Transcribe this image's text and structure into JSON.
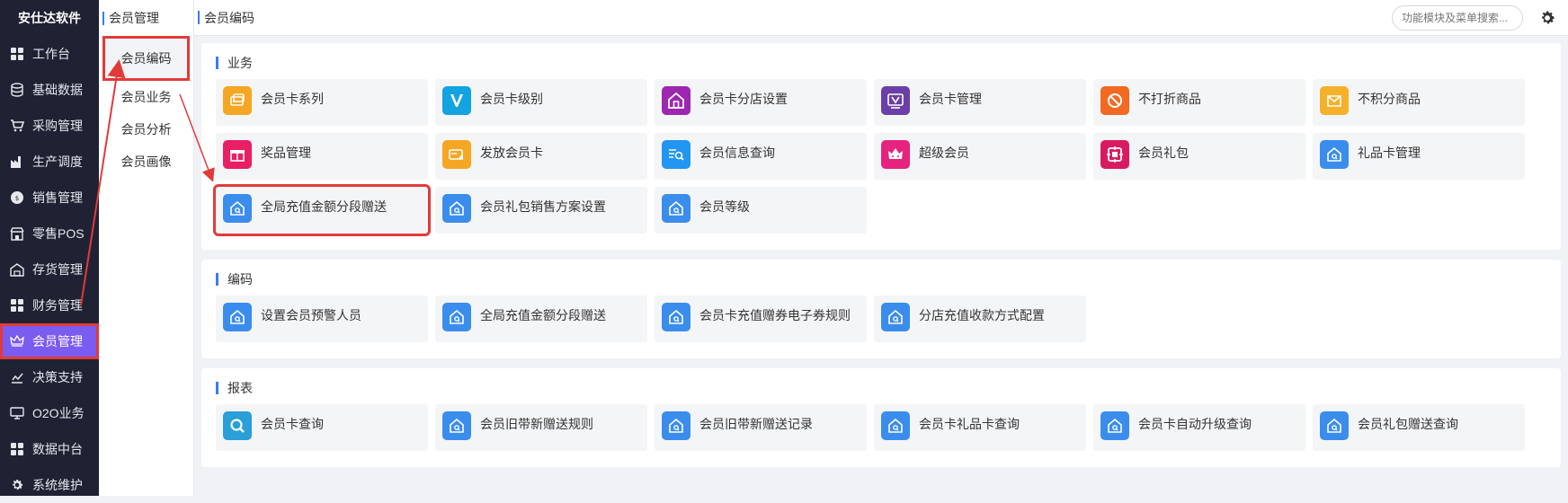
{
  "brand": "安仕达软件",
  "sidebar": {
    "items": [
      {
        "label": "工作台",
        "icon": "grid-icon",
        "active": false
      },
      {
        "label": "基础数据",
        "icon": "database-icon",
        "active": false
      },
      {
        "label": "采购管理",
        "icon": "cart-icon",
        "active": false
      },
      {
        "label": "生产调度",
        "icon": "factory-icon",
        "active": false
      },
      {
        "label": "销售管理",
        "icon": "sales-icon",
        "active": false
      },
      {
        "label": "零售POS",
        "icon": "store-icon",
        "active": false
      },
      {
        "label": "存货管理",
        "icon": "warehouse-icon",
        "active": false
      },
      {
        "label": "财务管理",
        "icon": "grid-icon",
        "active": false
      },
      {
        "label": "会员管理",
        "icon": "crown-icon",
        "active": true
      },
      {
        "label": "决策支持",
        "icon": "chart-icon",
        "active": false
      },
      {
        "label": "O2O业务",
        "icon": "monitor-icon",
        "active": false
      },
      {
        "label": "数据中台",
        "icon": "grid-icon",
        "active": false
      },
      {
        "label": "系统维护",
        "icon": "gear-icon",
        "active": false
      }
    ]
  },
  "submenu": {
    "title": "会员管理",
    "items": [
      {
        "label": "会员编码",
        "active": true
      },
      {
        "label": "会员业务",
        "active": false
      },
      {
        "label": "会员分析",
        "active": false
      },
      {
        "label": "会员画像",
        "active": false
      }
    ]
  },
  "topbar": {
    "breadcrumb": "会员编码",
    "search_placeholder": "功能模块及菜单搜索..."
  },
  "sections": [
    {
      "title": "业务",
      "cards": [
        {
          "label": "会员卡系列",
          "color": "#f5a623",
          "icon": "card-series-icon"
        },
        {
          "label": "会员卡级别",
          "color": "#13a3e0",
          "icon": "v-level-icon"
        },
        {
          "label": "会员卡分店设置",
          "color": "#9c27b0",
          "icon": "home-store-icon"
        },
        {
          "label": "会员卡管理",
          "color": "#6a3fa8",
          "icon": "card-manage-icon"
        },
        {
          "label": "不打折商品",
          "color": "#f26a22",
          "icon": "no-discount-icon"
        },
        {
          "label": "不积分商品",
          "color": "#f5b12a",
          "icon": "no-points-icon"
        },
        {
          "label": "奖品管理",
          "color": "#e91e63",
          "icon": "gift-box-icon"
        },
        {
          "label": "发放会员卡",
          "color": "#f5a623",
          "icon": "issue-card-icon"
        },
        {
          "label": "会员信息查询",
          "color": "#2196f3",
          "icon": "member-search-icon"
        },
        {
          "label": "超级会员",
          "color": "#e6237e",
          "icon": "crown-icon"
        },
        {
          "label": "会员礼包",
          "color": "#d81b60",
          "icon": "gift-pack-icon"
        },
        {
          "label": "礼品卡管理",
          "color": "#3b8ded",
          "icon": "house-q-icon"
        },
        {
          "label": "全局充值金额分段赠送",
          "color": "#3b8ded",
          "icon": "house-q-icon",
          "highlight": true
        },
        {
          "label": "会员礼包销售方案设置",
          "color": "#3b8ded",
          "icon": "house-q-icon"
        },
        {
          "label": "会员等级",
          "color": "#3b8ded",
          "icon": "house-q-icon"
        }
      ]
    },
    {
      "title": "编码",
      "cards": [
        {
          "label": "设置会员预警人员",
          "color": "#3b8ded",
          "icon": "house-q-icon"
        },
        {
          "label": "全局充值金额分段赠送",
          "color": "#3b8ded",
          "icon": "house-q-icon"
        },
        {
          "label": "会员卡充值赠券电子券规则",
          "color": "#3b8ded",
          "icon": "house-q-icon"
        },
        {
          "label": "分店充值收款方式配置",
          "color": "#3b8ded",
          "icon": "house-q-icon"
        }
      ]
    },
    {
      "title": "报表",
      "cards": [
        {
          "label": "会员卡查询",
          "color": "#2a9fd8",
          "icon": "magnifier-icon"
        },
        {
          "label": "会员旧带新赠送规则",
          "color": "#3b8ded",
          "icon": "house-q-icon"
        },
        {
          "label": "会员旧带新赠送记录",
          "color": "#3b8ded",
          "icon": "house-q-icon"
        },
        {
          "label": "会员卡礼品卡查询",
          "color": "#3b8ded",
          "icon": "house-q-icon"
        },
        {
          "label": "会员卡自动升级查询",
          "color": "#3b8ded",
          "icon": "house-q-icon"
        },
        {
          "label": "会员礼包赠送查询",
          "color": "#3b8ded",
          "icon": "house-q-icon"
        }
      ]
    }
  ],
  "colors": {
    "sidebar_bg": "#1f2233",
    "active_purple": "#7b5cf0",
    "accent_blue": "#3a7cf0",
    "annotation_red": "#e23a3a"
  }
}
